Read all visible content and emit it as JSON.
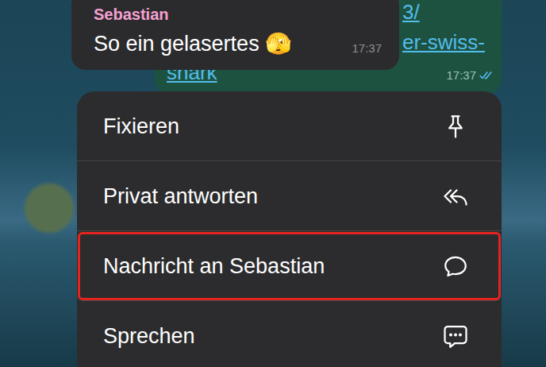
{
  "received_message": {
    "sender": "Sebastian",
    "text": "So ein gelasertes 🫣",
    "time": "17:37"
  },
  "sent_message": {
    "link_lines": [
      "3/",
      "er-swiss-",
      "shark"
    ],
    "time": "17:37",
    "read": true
  },
  "context_menu": {
    "items": [
      {
        "label": "Fixieren",
        "highlighted": false
      },
      {
        "label": "Privat antworten",
        "highlighted": false
      },
      {
        "label": "Nachricht an Sebastian",
        "highlighted": true
      },
      {
        "label": "Sprechen",
        "highlighted": false
      }
    ]
  }
}
